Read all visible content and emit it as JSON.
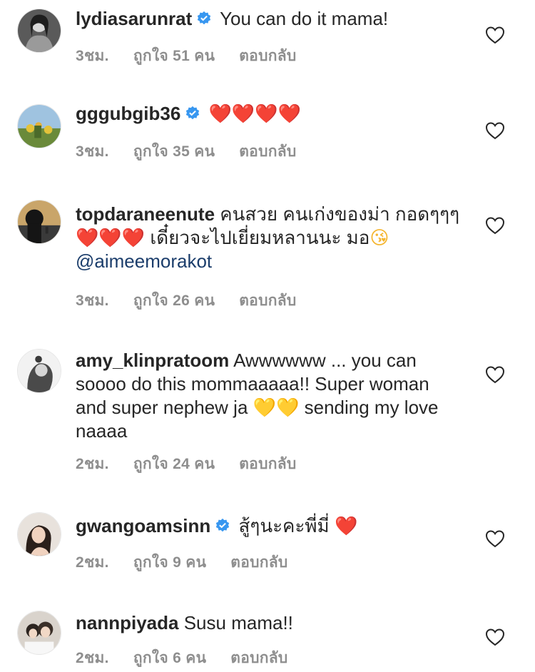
{
  "comments": [
    {
      "username": "lydiasarunrat",
      "verified": true,
      "text": "You can do it mama!",
      "time": "3ชม.",
      "likes": "ถูกใจ 51 คน",
      "reply": "ตอบกลับ"
    },
    {
      "username": "gggubgib36",
      "verified": true,
      "text": "❤️❤️❤️❤️",
      "time": "3ชม.",
      "likes": "ถูกใจ 35 คน",
      "reply": "ตอบกลับ"
    },
    {
      "username": "topdaraneenute",
      "verified": false,
      "text_part1": "คนสวย คนเก่งของม่า กอดๆๆๆ",
      "text_hearts": "❤️❤️❤️",
      "text_part2": "เดี๋ยวจะไปเยี่ยมหลานนะ มอ",
      "text_emoji": "😘",
      "mention": "@aimeemorakot",
      "time": "3ชม.",
      "likes": "ถูกใจ 26 คน",
      "reply": "ตอบกลับ"
    },
    {
      "username": "amy_klinpratoom",
      "verified": false,
      "text_part1": "Awwwwww ... you can soooo do this mommaaaaa!! Super woman and super nephew ja",
      "text_hearts": "💛💛",
      "text_part2": "sending my love naaaa",
      "time": "2ชม.",
      "likes": "ถูกใจ 24 คน",
      "reply": "ตอบกลับ"
    },
    {
      "username": "gwangoamsinn",
      "verified": true,
      "text": "สู้ๆนะคะพี่มี่",
      "text_hearts": "❤️",
      "time": "2ชม.",
      "likes": "ถูกใจ 9 คน",
      "reply": "ตอบกลับ"
    },
    {
      "username": "nannpiyada",
      "verified": false,
      "text": "Susu mama!!",
      "time": "2ชม.",
      "likes": "ถูกใจ 6 คน",
      "reply": "ตอบกลับ"
    }
  ],
  "icons": {
    "like": "heart-outline-icon",
    "verified": "verified-badge-icon"
  },
  "colors": {
    "meta": "#8e8e8e",
    "mention": "#1b3d6b",
    "verified": "#3897f0",
    "heart": "#e0202a"
  }
}
